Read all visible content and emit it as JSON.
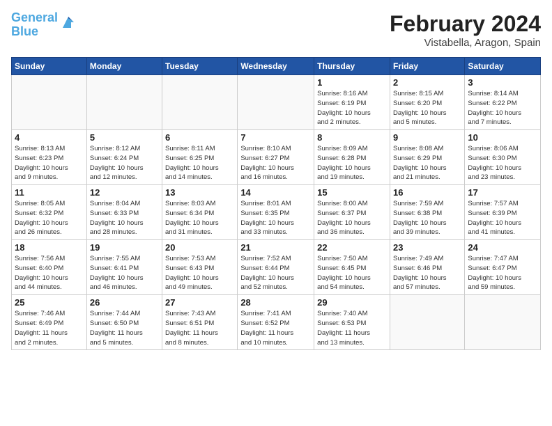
{
  "header": {
    "logo_line1": "General",
    "logo_line2": "Blue",
    "month_title": "February 2024",
    "location": "Vistabella, Aragon, Spain"
  },
  "days_of_week": [
    "Sunday",
    "Monday",
    "Tuesday",
    "Wednesday",
    "Thursday",
    "Friday",
    "Saturday"
  ],
  "weeks": [
    [
      {
        "day": "",
        "info": ""
      },
      {
        "day": "",
        "info": ""
      },
      {
        "day": "",
        "info": ""
      },
      {
        "day": "",
        "info": ""
      },
      {
        "day": "1",
        "info": "Sunrise: 8:16 AM\nSunset: 6:19 PM\nDaylight: 10 hours\nand 2 minutes."
      },
      {
        "day": "2",
        "info": "Sunrise: 8:15 AM\nSunset: 6:20 PM\nDaylight: 10 hours\nand 5 minutes."
      },
      {
        "day": "3",
        "info": "Sunrise: 8:14 AM\nSunset: 6:22 PM\nDaylight: 10 hours\nand 7 minutes."
      }
    ],
    [
      {
        "day": "4",
        "info": "Sunrise: 8:13 AM\nSunset: 6:23 PM\nDaylight: 10 hours\nand 9 minutes."
      },
      {
        "day": "5",
        "info": "Sunrise: 8:12 AM\nSunset: 6:24 PM\nDaylight: 10 hours\nand 12 minutes."
      },
      {
        "day": "6",
        "info": "Sunrise: 8:11 AM\nSunset: 6:25 PM\nDaylight: 10 hours\nand 14 minutes."
      },
      {
        "day": "7",
        "info": "Sunrise: 8:10 AM\nSunset: 6:27 PM\nDaylight: 10 hours\nand 16 minutes."
      },
      {
        "day": "8",
        "info": "Sunrise: 8:09 AM\nSunset: 6:28 PM\nDaylight: 10 hours\nand 19 minutes."
      },
      {
        "day": "9",
        "info": "Sunrise: 8:08 AM\nSunset: 6:29 PM\nDaylight: 10 hours\nand 21 minutes."
      },
      {
        "day": "10",
        "info": "Sunrise: 8:06 AM\nSunset: 6:30 PM\nDaylight: 10 hours\nand 23 minutes."
      }
    ],
    [
      {
        "day": "11",
        "info": "Sunrise: 8:05 AM\nSunset: 6:32 PM\nDaylight: 10 hours\nand 26 minutes."
      },
      {
        "day": "12",
        "info": "Sunrise: 8:04 AM\nSunset: 6:33 PM\nDaylight: 10 hours\nand 28 minutes."
      },
      {
        "day": "13",
        "info": "Sunrise: 8:03 AM\nSunset: 6:34 PM\nDaylight: 10 hours\nand 31 minutes."
      },
      {
        "day": "14",
        "info": "Sunrise: 8:01 AM\nSunset: 6:35 PM\nDaylight: 10 hours\nand 33 minutes."
      },
      {
        "day": "15",
        "info": "Sunrise: 8:00 AM\nSunset: 6:37 PM\nDaylight: 10 hours\nand 36 minutes."
      },
      {
        "day": "16",
        "info": "Sunrise: 7:59 AM\nSunset: 6:38 PM\nDaylight: 10 hours\nand 39 minutes."
      },
      {
        "day": "17",
        "info": "Sunrise: 7:57 AM\nSunset: 6:39 PM\nDaylight: 10 hours\nand 41 minutes."
      }
    ],
    [
      {
        "day": "18",
        "info": "Sunrise: 7:56 AM\nSunset: 6:40 PM\nDaylight: 10 hours\nand 44 minutes."
      },
      {
        "day": "19",
        "info": "Sunrise: 7:55 AM\nSunset: 6:41 PM\nDaylight: 10 hours\nand 46 minutes."
      },
      {
        "day": "20",
        "info": "Sunrise: 7:53 AM\nSunset: 6:43 PM\nDaylight: 10 hours\nand 49 minutes."
      },
      {
        "day": "21",
        "info": "Sunrise: 7:52 AM\nSunset: 6:44 PM\nDaylight: 10 hours\nand 52 minutes."
      },
      {
        "day": "22",
        "info": "Sunrise: 7:50 AM\nSunset: 6:45 PM\nDaylight: 10 hours\nand 54 minutes."
      },
      {
        "day": "23",
        "info": "Sunrise: 7:49 AM\nSunset: 6:46 PM\nDaylight: 10 hours\nand 57 minutes."
      },
      {
        "day": "24",
        "info": "Sunrise: 7:47 AM\nSunset: 6:47 PM\nDaylight: 10 hours\nand 59 minutes."
      }
    ],
    [
      {
        "day": "25",
        "info": "Sunrise: 7:46 AM\nSunset: 6:49 PM\nDaylight: 11 hours\nand 2 minutes."
      },
      {
        "day": "26",
        "info": "Sunrise: 7:44 AM\nSunset: 6:50 PM\nDaylight: 11 hours\nand 5 minutes."
      },
      {
        "day": "27",
        "info": "Sunrise: 7:43 AM\nSunset: 6:51 PM\nDaylight: 11 hours\nand 8 minutes."
      },
      {
        "day": "28",
        "info": "Sunrise: 7:41 AM\nSunset: 6:52 PM\nDaylight: 11 hours\nand 10 minutes."
      },
      {
        "day": "29",
        "info": "Sunrise: 7:40 AM\nSunset: 6:53 PM\nDaylight: 11 hours\nand 13 minutes."
      },
      {
        "day": "",
        "info": ""
      },
      {
        "day": "",
        "info": ""
      }
    ]
  ]
}
